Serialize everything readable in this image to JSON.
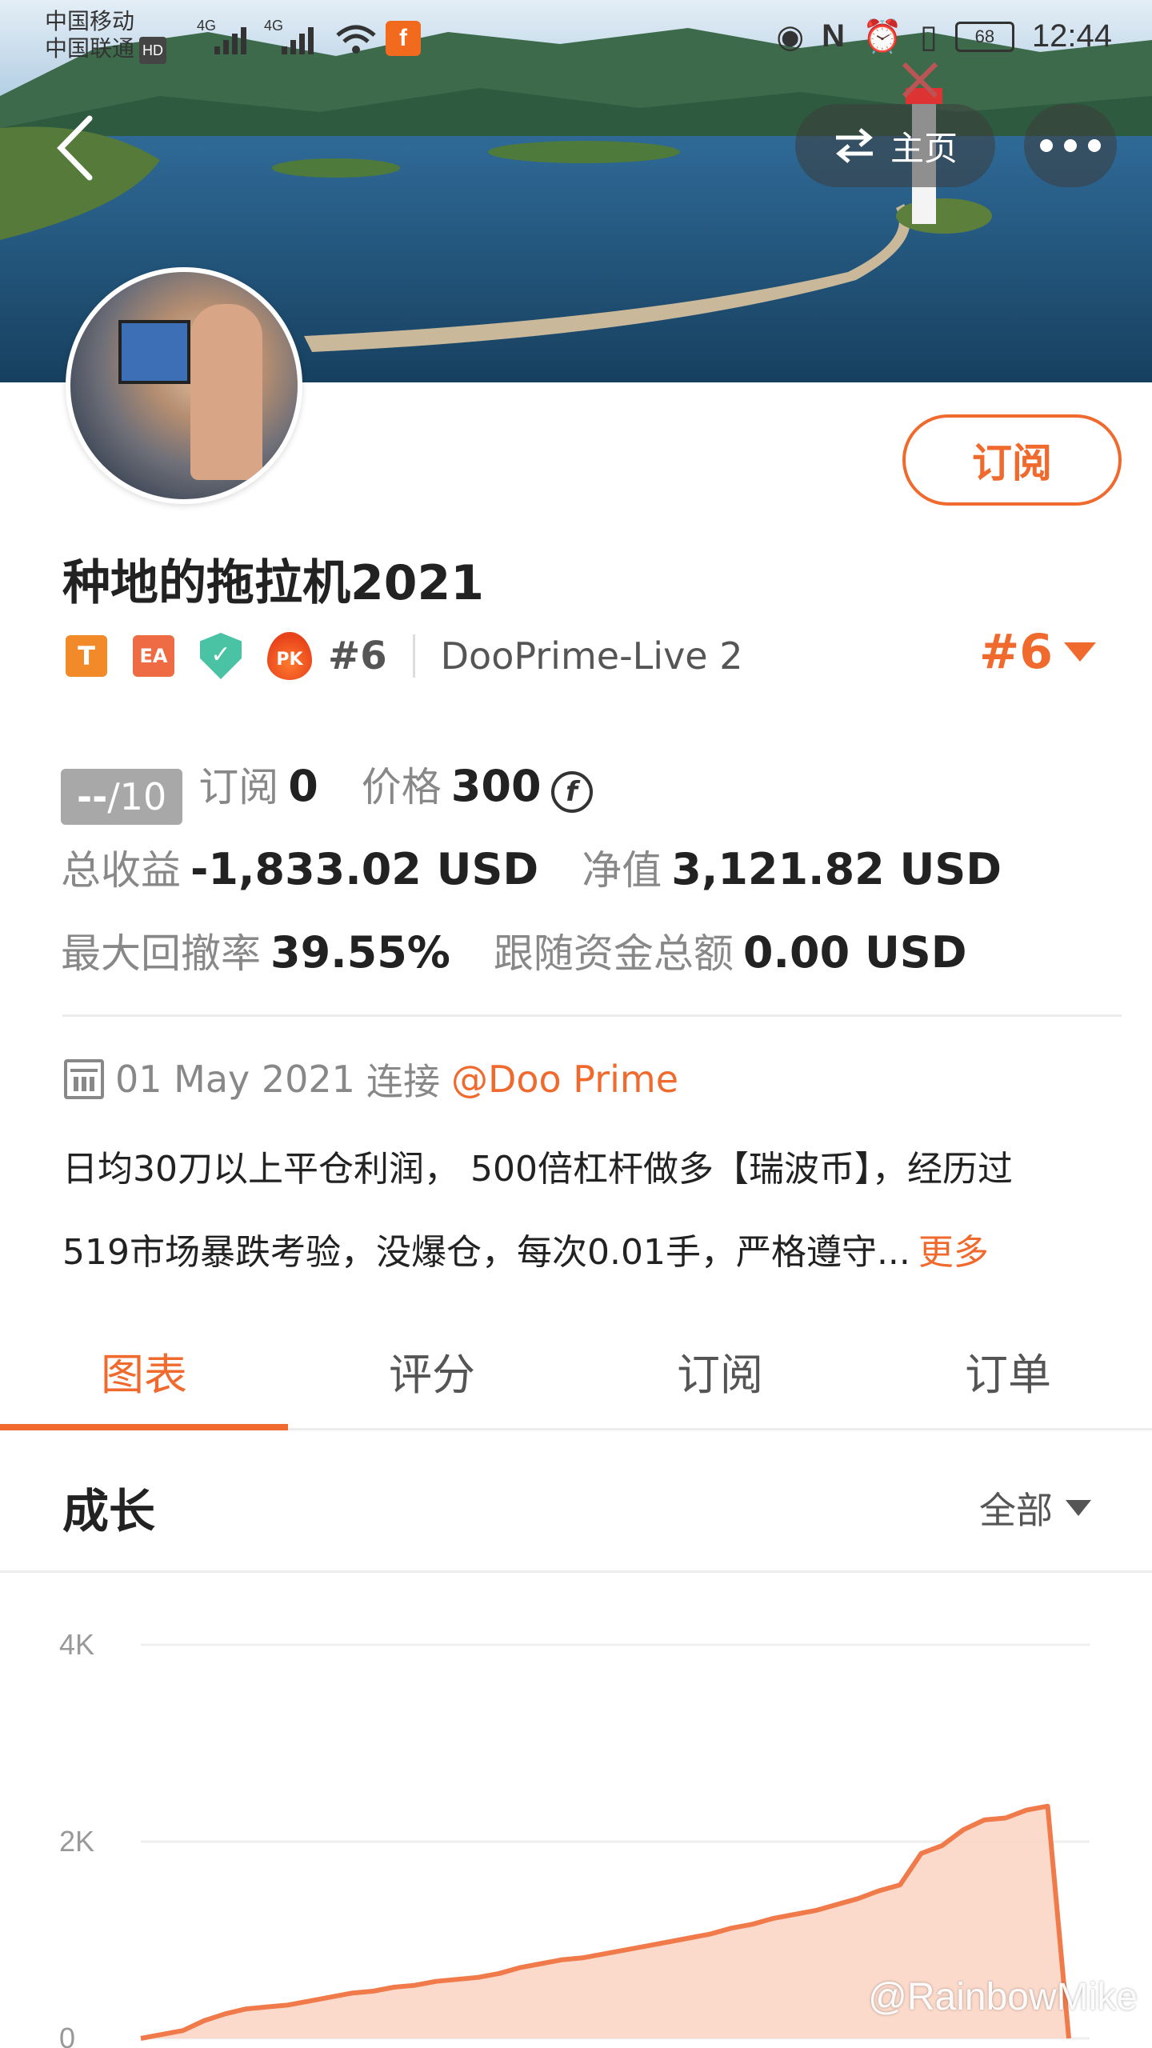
{
  "status_bar": {
    "carrier_1": "中国移动",
    "carrier_2": "中国联通",
    "hd": "HD",
    "net_1": "4G",
    "net_2": "4G",
    "app_icon_letter": "f",
    "battery": "68",
    "time": "12:44",
    "icons": [
      "eye-icon",
      "nfc-icon",
      "alarm-icon",
      "vibrate-icon",
      "wifi-icon",
      "signal-icon"
    ]
  },
  "header": {
    "back_icon": "chevron-left-icon",
    "home_label": "主页",
    "home_icon": "swap-arrows-icon",
    "more_icon": "more-dots-icon"
  },
  "profile": {
    "subscribe_label": "订阅",
    "name": "种地的拖拉机2021",
    "badges": [
      "T",
      "EA",
      "shield-check-icon",
      "PK"
    ],
    "rank_small": "#6",
    "server": "DooPrime-Live 2",
    "rank_big": "#6"
  },
  "stats": {
    "score_value": "--",
    "score_suffix": "/10",
    "subscribe_label": "订阅",
    "subscribe_count": "0",
    "price_label": "价格",
    "price_value": "300",
    "coin_symbol": "f",
    "total_profit_label": "总收益",
    "total_profit_value": "-1,833.02 USD",
    "equity_label": "净值",
    "equity_value": "3,121.82 USD",
    "max_drawdown_label": "最大回撤率",
    "max_drawdown_value": "39.55%",
    "follow_funds_label": "跟随资金总额",
    "follow_funds_value": "0.00 USD"
  },
  "since": {
    "date": "01 May 2021",
    "connect_label": "连接",
    "broker": "@Doo Prime"
  },
  "description": {
    "line_1": "日均30刀以上平仓利润， 500倍杠杆做多【瑞波币】，经历过",
    "line_2": "519市场暴跌考验，没爆仓，每次0.01手，严格遵守...",
    "more_label": "更多"
  },
  "tabs": [
    {
      "label": "图表",
      "active": true
    },
    {
      "label": "评分",
      "active": false
    },
    {
      "label": "订阅",
      "active": false
    },
    {
      "label": "订单",
      "active": false
    }
  ],
  "growth_section": {
    "title": "成长",
    "filter_label": "全部"
  },
  "chart_data": {
    "type": "area",
    "title": "",
    "xlabel": "",
    "ylabel": "",
    "ylim": [
      0,
      4000
    ],
    "yticks": [
      "4K",
      "2K",
      "0"
    ],
    "grid": true,
    "color": "#f07a4a",
    "fill_color": "#fbd3c2",
    "series": [
      {
        "values": [
          0,
          40,
          80,
          180,
          250,
          300,
          320,
          340,
          380,
          420,
          460,
          480,
          520,
          540,
          580,
          600,
          620,
          660,
          720,
          760,
          800,
          820,
          860,
          900,
          940,
          980,
          1020,
          1060,
          1120,
          1160,
          1220,
          1260,
          1300,
          1360,
          1420,
          1500,
          1560,
          1880,
          1960,
          2120,
          2220,
          2240,
          2320,
          2360,
          0
        ]
      }
    ]
  },
  "watermark": "@RainbowMike"
}
